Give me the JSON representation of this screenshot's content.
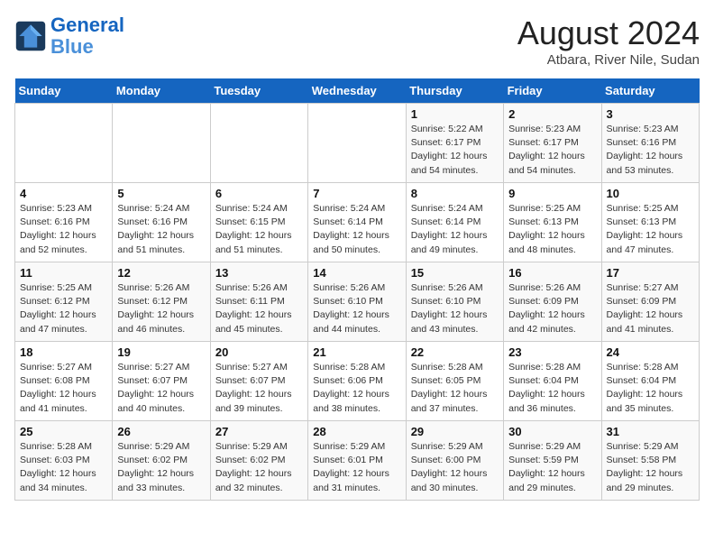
{
  "header": {
    "logo_line1": "General",
    "logo_line2": "Blue",
    "month_title": "August 2024",
    "location": "Atbara, River Nile, Sudan"
  },
  "days_of_week": [
    "Sunday",
    "Monday",
    "Tuesday",
    "Wednesday",
    "Thursday",
    "Friday",
    "Saturday"
  ],
  "weeks": [
    [
      {
        "day": "",
        "content": ""
      },
      {
        "day": "",
        "content": ""
      },
      {
        "day": "",
        "content": ""
      },
      {
        "day": "",
        "content": ""
      },
      {
        "day": "1",
        "content": "Sunrise: 5:22 AM\nSunset: 6:17 PM\nDaylight: 12 hours\nand 54 minutes."
      },
      {
        "day": "2",
        "content": "Sunrise: 5:23 AM\nSunset: 6:17 PM\nDaylight: 12 hours\nand 54 minutes."
      },
      {
        "day": "3",
        "content": "Sunrise: 5:23 AM\nSunset: 6:16 PM\nDaylight: 12 hours\nand 53 minutes."
      }
    ],
    [
      {
        "day": "4",
        "content": "Sunrise: 5:23 AM\nSunset: 6:16 PM\nDaylight: 12 hours\nand 52 minutes."
      },
      {
        "day": "5",
        "content": "Sunrise: 5:24 AM\nSunset: 6:16 PM\nDaylight: 12 hours\nand 51 minutes."
      },
      {
        "day": "6",
        "content": "Sunrise: 5:24 AM\nSunset: 6:15 PM\nDaylight: 12 hours\nand 51 minutes."
      },
      {
        "day": "7",
        "content": "Sunrise: 5:24 AM\nSunset: 6:14 PM\nDaylight: 12 hours\nand 50 minutes."
      },
      {
        "day": "8",
        "content": "Sunrise: 5:24 AM\nSunset: 6:14 PM\nDaylight: 12 hours\nand 49 minutes."
      },
      {
        "day": "9",
        "content": "Sunrise: 5:25 AM\nSunset: 6:13 PM\nDaylight: 12 hours\nand 48 minutes."
      },
      {
        "day": "10",
        "content": "Sunrise: 5:25 AM\nSunset: 6:13 PM\nDaylight: 12 hours\nand 47 minutes."
      }
    ],
    [
      {
        "day": "11",
        "content": "Sunrise: 5:25 AM\nSunset: 6:12 PM\nDaylight: 12 hours\nand 47 minutes."
      },
      {
        "day": "12",
        "content": "Sunrise: 5:26 AM\nSunset: 6:12 PM\nDaylight: 12 hours\nand 46 minutes."
      },
      {
        "day": "13",
        "content": "Sunrise: 5:26 AM\nSunset: 6:11 PM\nDaylight: 12 hours\nand 45 minutes."
      },
      {
        "day": "14",
        "content": "Sunrise: 5:26 AM\nSunset: 6:10 PM\nDaylight: 12 hours\nand 44 minutes."
      },
      {
        "day": "15",
        "content": "Sunrise: 5:26 AM\nSunset: 6:10 PM\nDaylight: 12 hours\nand 43 minutes."
      },
      {
        "day": "16",
        "content": "Sunrise: 5:26 AM\nSunset: 6:09 PM\nDaylight: 12 hours\nand 42 minutes."
      },
      {
        "day": "17",
        "content": "Sunrise: 5:27 AM\nSunset: 6:09 PM\nDaylight: 12 hours\nand 41 minutes."
      }
    ],
    [
      {
        "day": "18",
        "content": "Sunrise: 5:27 AM\nSunset: 6:08 PM\nDaylight: 12 hours\nand 41 minutes."
      },
      {
        "day": "19",
        "content": "Sunrise: 5:27 AM\nSunset: 6:07 PM\nDaylight: 12 hours\nand 40 minutes."
      },
      {
        "day": "20",
        "content": "Sunrise: 5:27 AM\nSunset: 6:07 PM\nDaylight: 12 hours\nand 39 minutes."
      },
      {
        "day": "21",
        "content": "Sunrise: 5:28 AM\nSunset: 6:06 PM\nDaylight: 12 hours\nand 38 minutes."
      },
      {
        "day": "22",
        "content": "Sunrise: 5:28 AM\nSunset: 6:05 PM\nDaylight: 12 hours\nand 37 minutes."
      },
      {
        "day": "23",
        "content": "Sunrise: 5:28 AM\nSunset: 6:04 PM\nDaylight: 12 hours\nand 36 minutes."
      },
      {
        "day": "24",
        "content": "Sunrise: 5:28 AM\nSunset: 6:04 PM\nDaylight: 12 hours\nand 35 minutes."
      }
    ],
    [
      {
        "day": "25",
        "content": "Sunrise: 5:28 AM\nSunset: 6:03 PM\nDaylight: 12 hours\nand 34 minutes."
      },
      {
        "day": "26",
        "content": "Sunrise: 5:29 AM\nSunset: 6:02 PM\nDaylight: 12 hours\nand 33 minutes."
      },
      {
        "day": "27",
        "content": "Sunrise: 5:29 AM\nSunset: 6:02 PM\nDaylight: 12 hours\nand 32 minutes."
      },
      {
        "day": "28",
        "content": "Sunrise: 5:29 AM\nSunset: 6:01 PM\nDaylight: 12 hours\nand 31 minutes."
      },
      {
        "day": "29",
        "content": "Sunrise: 5:29 AM\nSunset: 6:00 PM\nDaylight: 12 hours\nand 30 minutes."
      },
      {
        "day": "30",
        "content": "Sunrise: 5:29 AM\nSunset: 5:59 PM\nDaylight: 12 hours\nand 29 minutes."
      },
      {
        "day": "31",
        "content": "Sunrise: 5:29 AM\nSunset: 5:58 PM\nDaylight: 12 hours\nand 29 minutes."
      }
    ]
  ]
}
